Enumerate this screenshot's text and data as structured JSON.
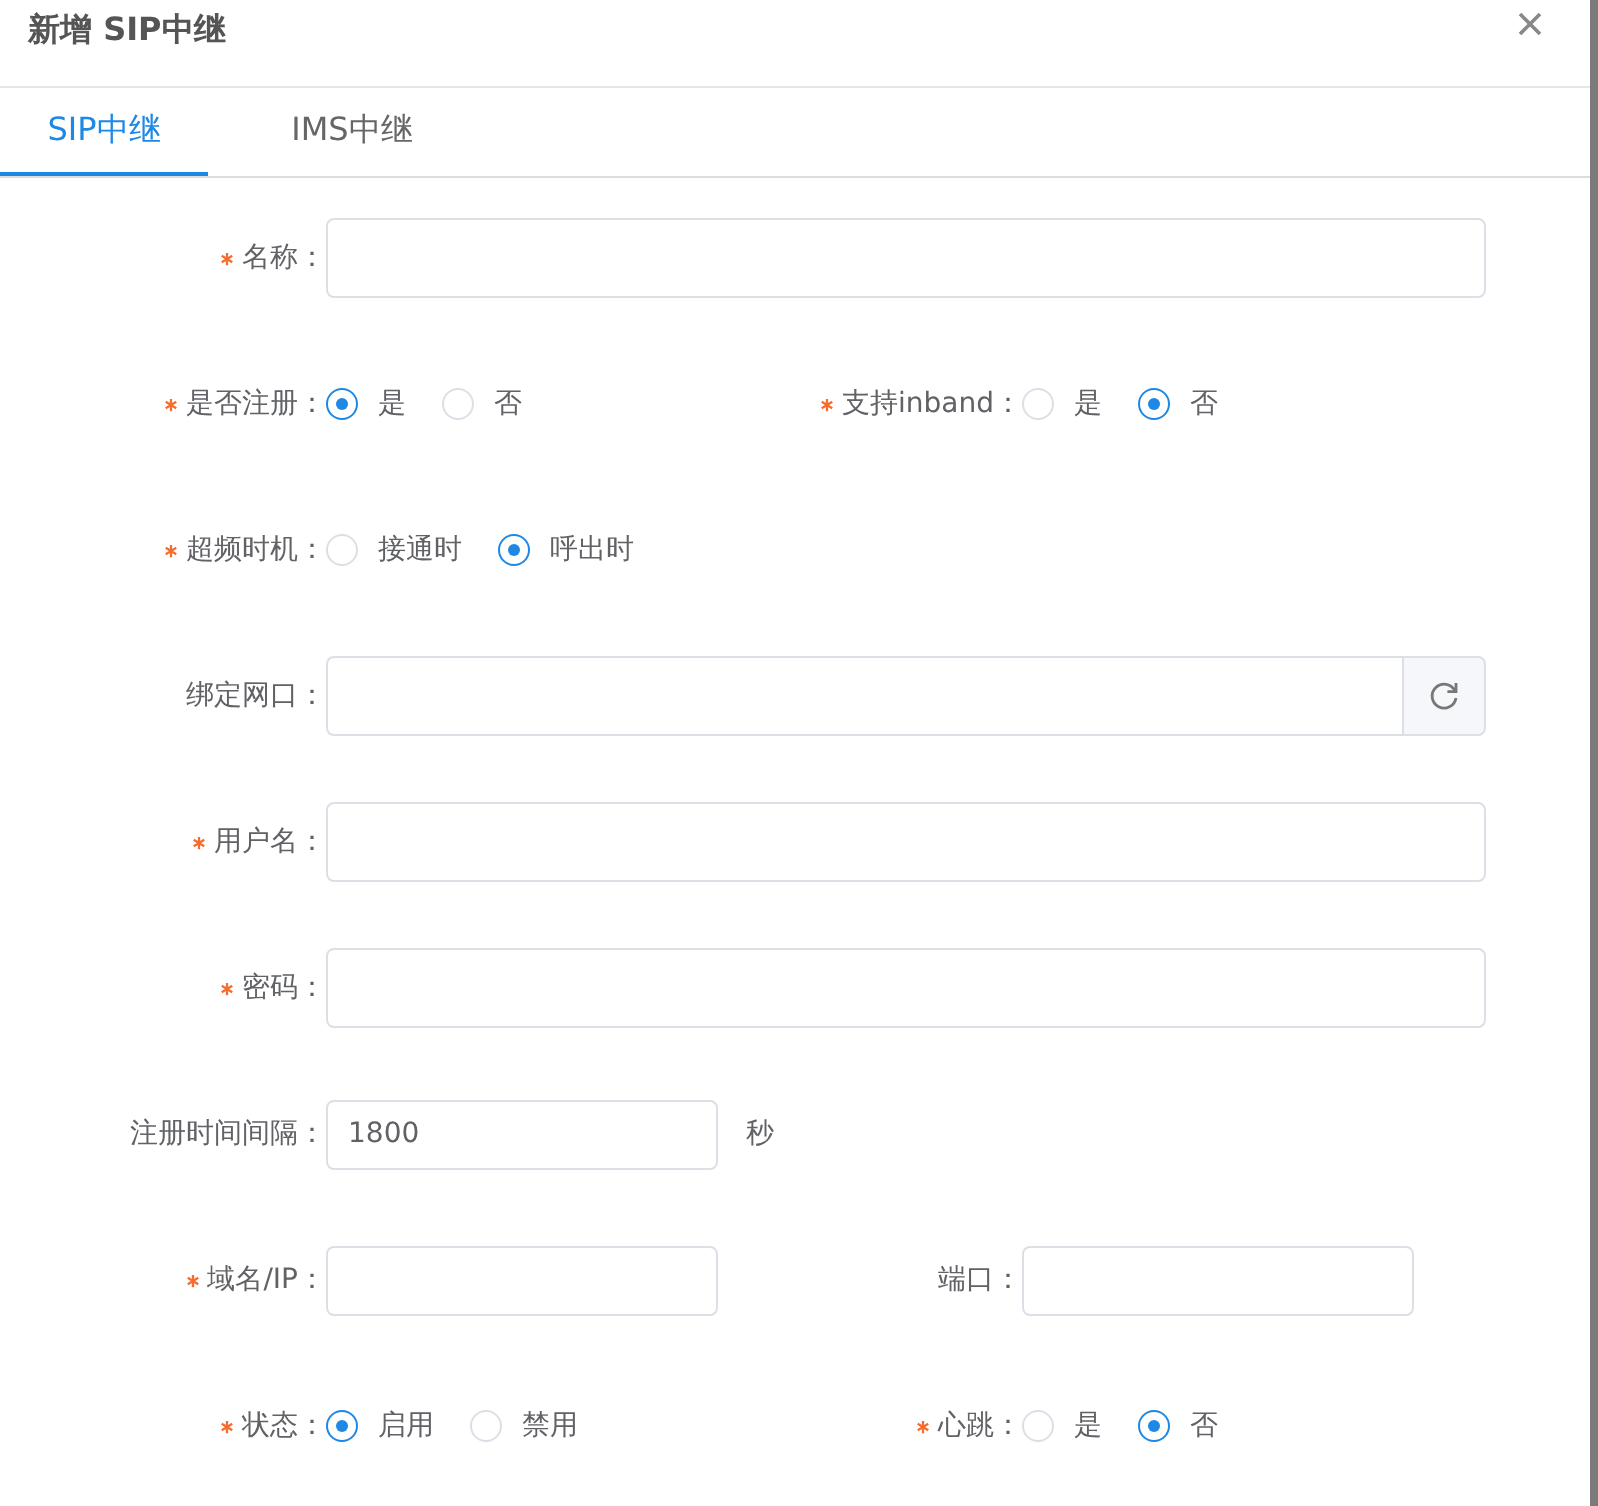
{
  "dialog": {
    "title": "新增 SIP中继"
  },
  "tabs": [
    {
      "label": "SIP中继",
      "selected": true
    },
    {
      "label": "IMS中继",
      "selected": false
    }
  ],
  "form_rows": [
    [
      {
        "kind": "text",
        "label": "名称：",
        "required": true
      }
    ],
    [
      {
        "kind": "radio",
        "label": "是否注册：",
        "required": true,
        "options": [
          {
            "label": "是",
            "selected": true
          },
          {
            "label": "否",
            "selected": false
          }
        ]
      },
      {
        "kind": "radio",
        "label": "支持inband：",
        "required": true,
        "options": [
          {
            "label": "是",
            "selected": false
          },
          {
            "label": "否",
            "selected": true
          }
        ]
      }
    ],
    [
      {
        "kind": "radio",
        "label": "超频时机：",
        "required": true,
        "options": [
          {
            "label": "接通时",
            "selected": false
          },
          {
            "label": "呼出时",
            "selected": true
          }
        ]
      }
    ],
    [
      {
        "kind": "refresh",
        "label": "绑定网口：",
        "required": false
      }
    ],
    [
      {
        "kind": "text",
        "label": "用户名：",
        "required": true
      }
    ],
    [
      {
        "kind": "text",
        "label": "密码：",
        "required": true
      }
    ],
    [
      {
        "kind": "text",
        "label": "注册时间间隔：",
        "required": false,
        "value": "1800",
        "suffix": "秒"
      }
    ],
    [
      {
        "kind": "text",
        "label": "域名/IP：",
        "required": true
      },
      {
        "kind": "text",
        "label": "端口：",
        "required": false
      }
    ],
    [
      {
        "kind": "radio",
        "label": "状态：",
        "required": true,
        "options": [
          {
            "label": "启用",
            "selected": true
          },
          {
            "label": "禁用",
            "selected": false
          }
        ]
      },
      {
        "kind": "radio",
        "label": "心跳：",
        "required": true,
        "options": [
          {
            "label": "是",
            "selected": false
          },
          {
            "label": "否",
            "selected": true
          }
        ]
      }
    ]
  ]
}
